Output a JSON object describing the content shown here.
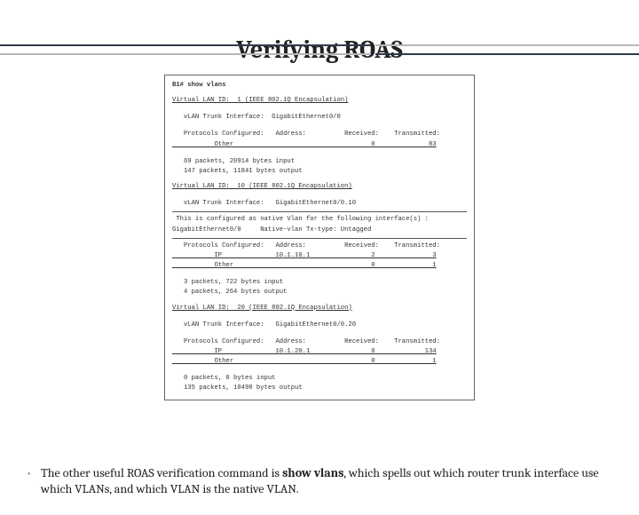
{
  "title": "Verifying ROAS",
  "terminal": {
    "cmd": "B1# show vlans",
    "v1": {
      "header": "Virtual LAN ID:  1 (IEEE 802.1Q Encapsulation)",
      "iface": "   vLAN Trunk Interface:  GigabitEthernet0/0",
      "protoHdr": "   Protocols Configured:   Address:          Received:    Transmitted:",
      "proto1": "           Other                                    0              83",
      "stats1": "   69 packets, 20914 bytes input",
      "stats2": "   147 packets, 11841 bytes output"
    },
    "v10": {
      "header": "Virtual LAN ID:  10 (IEEE 802.1Q Encapsulation)",
      "iface": "   vLAN Trunk Interface:   GigabitEthernet0/0.10",
      "native1": " This is configured as native Vlan for the following interface(s) :",
      "native2": "GigabitEthernet0/0     Native-vlan Tx-type: Untagged",
      "protoHdr": "   Protocols Configured:   Address:          Received:    Transmitted:",
      "proto1": "           IP              10.1.10.1                2               3",
      "proto2": "           Other                                    0               1",
      "stats1": "   3 packets, 722 bytes input",
      "stats2": "   4 packets, 264 bytes output"
    },
    "v20": {
      "header": "Virtual LAN ID:  20 (IEEE 802.1Q Encapsulation)",
      "iface": "   vLAN Trunk Interface:   GigabitEthernet0/0.20",
      "protoHdr": "   Protocols Configured:   Address:          Received:    Transmitted:",
      "proto1": "           IP              10.1.20.1                0             134",
      "proto2": "           Other                                    0               1",
      "stats1": "   0 packets, 0 bytes input",
      "stats2": "   135 packets, 10498 bytes output"
    }
  },
  "bullet": {
    "pre": "The other useful ROAS verification command is ",
    "cmd": "show vlans",
    "post": ", which spells out which router trunk interface use which VLANs, and which VLAN is the native VLAN."
  }
}
